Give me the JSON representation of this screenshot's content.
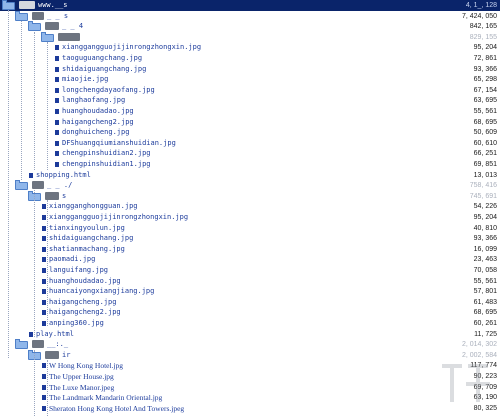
{
  "colors": {
    "selection": "#0a246a",
    "text": "#1d3c9c",
    "folder": "#8fb6ea",
    "file_marker": "#1c3a9a"
  },
  "rows": [
    {
      "kind": "folder",
      "label": "www.__s",
      "size": "4, 1_, 128",
      "sel": true,
      "indent": 0,
      "blur": "0"
    },
    {
      "kind": "folder",
      "label": "_ _ s",
      "size": "7, 424, 050",
      "indent": 1,
      "blur": "2"
    },
    {
      "kind": "folder",
      "label": "_ _ 4",
      "size": "842, 165",
      "indent": 2,
      "blur": "4"
    },
    {
      "kind": "folder",
      "label": "",
      "size": "829, 155",
      "indent": 3,
      "blur": "6",
      "grey": true
    },
    {
      "kind": "file",
      "label": "xianggangguojijinrongzhongxin.jpg",
      "size": "95, 204",
      "indent": 4
    },
    {
      "kind": "file",
      "label": "taoguguangchang.jpg",
      "size": "72, 861",
      "indent": 4
    },
    {
      "kind": "file",
      "label": "shidaiguangchang.jpg",
      "size": "93, 366",
      "indent": 4
    },
    {
      "kind": "file",
      "label": "miaojie.jpg",
      "size": "65, 298",
      "indent": 4
    },
    {
      "kind": "file",
      "label": "longchengdayaofang.jpg",
      "size": "67, 154",
      "indent": 4
    },
    {
      "kind": "file",
      "label": "langhaofang.jpg",
      "size": "63, 695",
      "indent": 4
    },
    {
      "kind": "file",
      "label": "huanghoudadao.jpg",
      "size": "55, 561",
      "indent": 4
    },
    {
      "kind": "file",
      "label": "haigangcheng2.jpg",
      "size": "68, 695",
      "indent": 4
    },
    {
      "kind": "file",
      "label": "donghuicheng.jpg",
      "size": "50, 609",
      "indent": 4
    },
    {
      "kind": "file",
      "label": "DFShuangqiumianshuidian.jpg",
      "size": "60, 610",
      "indent": 4
    },
    {
      "kind": "file",
      "label": "chengpinshuidian2.jpg",
      "size": "66, 251",
      "indent": 4
    },
    {
      "kind": "file",
      "label": "chengpinshuidian1.jpg",
      "size": "69, 851",
      "indent": 4
    },
    {
      "kind": "file",
      "label": "shopping.html",
      "size": "13, 013",
      "indent": 2
    },
    {
      "kind": "folder",
      "label": "_ _ ./",
      "size": "758, 416",
      "indent": 1,
      "grey": true,
      "blur": "2"
    },
    {
      "kind": "folder",
      "label": "s",
      "size": "745, 691",
      "indent": 2,
      "grey": true,
      "blur": "4"
    },
    {
      "kind": "file",
      "label": "xiangganghongguan.jpg",
      "size": "54, 226",
      "indent": 3
    },
    {
      "kind": "file",
      "label": "xianggangguojijinrongzhongxin.jpg",
      "size": "95, 204",
      "indent": 3
    },
    {
      "kind": "file",
      "label": "tianxingyoulun.jpg",
      "size": "40, 810",
      "indent": 3
    },
    {
      "kind": "file",
      "label": "shidaiguangchang.jpg",
      "size": "93, 366",
      "indent": 3
    },
    {
      "kind": "file",
      "label": "shatianmachang.jpg",
      "size": "16, 099",
      "indent": 3
    },
    {
      "kind": "file",
      "label": "paomadi.jpg",
      "size": "23, 463",
      "indent": 3
    },
    {
      "kind": "file",
      "label": "languifang.jpg",
      "size": "70, 058",
      "indent": 3
    },
    {
      "kind": "file",
      "label": "huanghoudadao.jpg",
      "size": "55, 561",
      "indent": 3
    },
    {
      "kind": "file",
      "label": "huancaiyongxiangjiang.jpg",
      "size": "57, 801",
      "indent": 3
    },
    {
      "kind": "file",
      "label": "haigangcheng.jpg",
      "size": "61, 483",
      "indent": 3
    },
    {
      "kind": "file",
      "label": "haigangcheng2.jpg",
      "size": "68, 695",
      "indent": 3
    },
    {
      "kind": "file",
      "label": "anping360.jpg",
      "size": "60, 261",
      "indent": 3
    },
    {
      "kind": "file",
      "label": "play.html",
      "size": "11, 725",
      "indent": 2
    },
    {
      "kind": "folder",
      "label": "__:._",
      "size": "2, 014, 302",
      "indent": 1,
      "grey": true,
      "blur": "2"
    },
    {
      "kind": "folder",
      "label": "ir",
      "size": "2, 002, 584",
      "indent": 2,
      "grey": true,
      "blur": "4"
    },
    {
      "kind": "file",
      "label": "W Hong Kong Hotel.jpg",
      "size": "117, 774",
      "indent": 3,
      "serif": true
    },
    {
      "kind": "file",
      "label": "The Upper House.jpg",
      "size": "90, 223",
      "indent": 3,
      "serif": true
    },
    {
      "kind": "file",
      "label": "The Luxe Manor.jpeg",
      "size": "69, 709",
      "indent": 3,
      "serif": true
    },
    {
      "kind": "file",
      "label": "The Landmark Mandarin Oriental.jpg",
      "size": "63, 190",
      "indent": 3,
      "serif": true
    },
    {
      "kind": "file",
      "label": "Sheraton Hong Kong Hotel And Towers.jpeg",
      "size": "80, 325",
      "indent": 3,
      "serif": true
    }
  ]
}
